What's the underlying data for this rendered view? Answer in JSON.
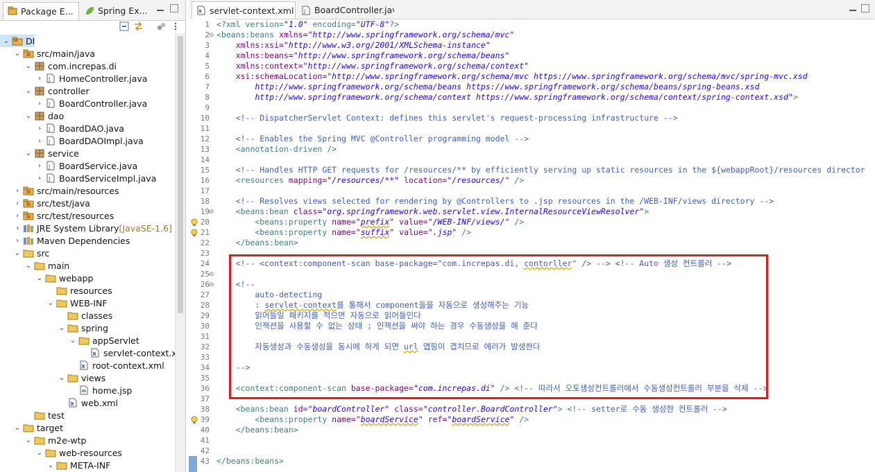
{
  "left_view": {
    "tabs": [
      {
        "label": "Package E...",
        "close": "✕"
      },
      {
        "label": "Spring Ex..."
      }
    ],
    "tree": [
      {
        "label": "DI",
        "depth": 0,
        "expanded": true,
        "icon": "maven-project-icon",
        "selected": true
      },
      {
        "label": "src/main/java",
        "depth": 1,
        "expanded": true,
        "icon": "source-folder-icon"
      },
      {
        "label": "com.increpas.di",
        "depth": 2,
        "expanded": true,
        "icon": "package-icon"
      },
      {
        "label": "HomeController.java",
        "depth": 3,
        "expanded": false,
        "icon": "java-file-icon"
      },
      {
        "label": "controller",
        "depth": 2,
        "expanded": true,
        "icon": "package-icon"
      },
      {
        "label": "BoardController.java",
        "depth": 3,
        "expanded": false,
        "icon": "java-file-icon"
      },
      {
        "label": "dao",
        "depth": 2,
        "expanded": true,
        "icon": "package-icon"
      },
      {
        "label": "BoardDAO.java",
        "depth": 3,
        "expanded": false,
        "icon": "java-interface-icon"
      },
      {
        "label": "BoardDAOImpl.java",
        "depth": 3,
        "expanded": false,
        "icon": "java-file-icon"
      },
      {
        "label": "service",
        "depth": 2,
        "expanded": true,
        "icon": "package-icon"
      },
      {
        "label": "BoardService.java",
        "depth": 3,
        "expanded": false,
        "icon": "java-interface-icon"
      },
      {
        "label": "BoardServiceImpl.java",
        "depth": 3,
        "expanded": false,
        "icon": "java-file-icon"
      },
      {
        "label": "src/main/resources",
        "depth": 1,
        "expanded": false,
        "icon": "source-folder-icon"
      },
      {
        "label": "src/test/java",
        "depth": 1,
        "expanded": false,
        "icon": "source-folder-icon"
      },
      {
        "label": "src/test/resources",
        "depth": 1,
        "expanded": false,
        "icon": "source-folder-icon"
      },
      {
        "label": "JRE System Library",
        "decoration": "[JavaSE-1.6]",
        "depth": 1,
        "expanded": false,
        "icon": "library-icon"
      },
      {
        "label": "Maven Dependencies",
        "depth": 1,
        "expanded": false,
        "icon": "library-icon"
      },
      {
        "label": "src",
        "depth": 1,
        "expanded": true,
        "icon": "folder-icon"
      },
      {
        "label": "main",
        "depth": 2,
        "expanded": true,
        "icon": "folder-icon"
      },
      {
        "label": "webapp",
        "depth": 3,
        "expanded": true,
        "icon": "folder-icon"
      },
      {
        "label": "resources",
        "depth": 4,
        "expanded": null,
        "icon": "folder-icon"
      },
      {
        "label": "WEB-INF",
        "depth": 4,
        "expanded": true,
        "icon": "folder-icon"
      },
      {
        "label": "classes",
        "depth": 5,
        "expanded": null,
        "icon": "folder-icon"
      },
      {
        "label": "spring",
        "depth": 5,
        "expanded": true,
        "icon": "folder-icon"
      },
      {
        "label": "appServlet",
        "depth": 6,
        "expanded": true,
        "icon": "folder-icon"
      },
      {
        "label": "servlet-context.xml",
        "depth": 7,
        "expanded": null,
        "icon": "xml-file-icon"
      },
      {
        "label": "root-context.xml",
        "depth": 6,
        "expanded": null,
        "icon": "xml-file-icon"
      },
      {
        "label": "views",
        "depth": 5,
        "expanded": true,
        "icon": "folder-icon"
      },
      {
        "label": "home.jsp",
        "depth": 6,
        "expanded": null,
        "icon": "jsp-file-icon"
      },
      {
        "label": "web.xml",
        "depth": 5,
        "expanded": null,
        "icon": "xml-file-icon"
      },
      {
        "label": "test",
        "depth": 2,
        "expanded": null,
        "icon": "folder-icon"
      },
      {
        "label": "target",
        "depth": 1,
        "expanded": true,
        "icon": "folder-icon"
      },
      {
        "label": "m2e-wtp",
        "depth": 2,
        "expanded": true,
        "icon": "folder-icon"
      },
      {
        "label": "web-resources",
        "depth": 3,
        "expanded": true,
        "icon": "folder-icon"
      },
      {
        "label": "META-INF",
        "depth": 4,
        "expanded": true,
        "icon": "folder-icon"
      }
    ]
  },
  "editor": {
    "tabs": [
      {
        "label": "servlet-context.xml",
        "close": "✕",
        "active": true
      },
      {
        "label": "BoardController.java",
        "active": false
      }
    ],
    "line_numbers": [
      "1",
      "2",
      "3",
      "4",
      "5",
      "6",
      "7",
      "8",
      "9",
      "10",
      "11",
      "12",
      "13",
      "14",
      "15",
      "16",
      "17",
      "18",
      "19",
      "20",
      "21",
      "22",
      "23",
      "24",
      "25",
      "26",
      "27",
      "28",
      "29",
      "30",
      "31",
      "32",
      "33",
      "34",
      "35",
      "36",
      "37",
      "38",
      "39",
      "40",
      "41",
      "42",
      "43"
    ],
    "fold_markers": {
      "2": "⊖",
      "19": "⊖",
      "25": "⊖",
      "26": "⊖"
    },
    "warning_lines": [
      "20",
      "21",
      "39"
    ],
    "lines": [
      [
        [
          "pi",
          "<?xml version="
        ],
        [
          "vl",
          "\"1.0\""
        ],
        [
          "pi",
          " encoding="
        ],
        [
          "vl",
          "\"UTF-8\""
        ],
        [
          "pi",
          "?>"
        ]
      ],
      [
        [
          "tg",
          "<beans:beans "
        ],
        [
          "at",
          "xmlns="
        ],
        [
          "vl",
          "\"http://www.springframework.org/schema/mvc\""
        ]
      ],
      [
        [
          "at",
          "    xmlns:xsi="
        ],
        [
          "vl",
          "\"http://www.w3.org/2001/XMLSchema-instance\""
        ]
      ],
      [
        [
          "at",
          "    xmlns:beans="
        ],
        [
          "vl",
          "\"http://www.springframework.org/schema/beans\""
        ]
      ],
      [
        [
          "at",
          "    xmlns:context="
        ],
        [
          "vl",
          "\"http://www.springframework.org/schema/context\""
        ]
      ],
      [
        [
          "at",
          "    xsi:schemaLocation="
        ],
        [
          "vl",
          "\"http://www.springframework.org/schema/mvc https://www.springframework.org/schema/mvc/spring-mvc.xsd"
        ]
      ],
      [
        [
          "vl",
          "        http://www.springframework.org/schema/beans https://www.springframework.org/schema/beans/spring-beans.xsd"
        ]
      ],
      [
        [
          "vl",
          "        http://www.springframework.org/schema/context https://www.springframework.org/schema/context/spring-context.xsd\""
        ],
        [
          "tg",
          ">"
        ]
      ],
      [],
      [
        [
          "cm",
          "    <!-- DispatcherServlet Context: defines this servlet's request-processing infrastructure -->"
        ]
      ],
      [],
      [
        [
          "cm",
          "    <!-- Enables the Spring MVC @Controller programming model -->"
        ]
      ],
      [
        [
          "tg",
          "    <annotation-driven />"
        ]
      ],
      [],
      [
        [
          "cm",
          "    <!-- Handles HTTP GET requests for /resources/** by efficiently serving up static resources in the ${webappRoot}/resources director"
        ]
      ],
      [
        [
          "tg",
          "    <resources "
        ],
        [
          "at",
          "mapping="
        ],
        [
          "vl",
          "\"/resources/**\""
        ],
        [
          "at",
          " location="
        ],
        [
          "vl",
          "\"/resources/\""
        ],
        [
          "tg",
          " />"
        ]
      ],
      [],
      [
        [
          "cm",
          "    <!-- Resolves views selected for rendering by @Controllers to .jsp resources in the /WEB-INF/views directory -->"
        ]
      ],
      [
        [
          "tg",
          "    <beans:bean "
        ],
        [
          "at",
          "class="
        ],
        [
          "vl",
          "\"org.springframework.web.servlet.view.InternalResourceViewResolver\""
        ],
        [
          "tg",
          ">"
        ]
      ],
      [
        [
          "tg",
          "        <beans:property "
        ],
        [
          "at",
          "name="
        ],
        [
          "vl",
          "\"prefix\""
        ],
        [
          "at",
          " value="
        ],
        [
          "vl",
          "\"/WEB-INF/views/\""
        ],
        [
          "tg",
          " />"
        ]
      ],
      [
        [
          "tg",
          "        <beans:property "
        ],
        [
          "at",
          "name="
        ],
        [
          "vl",
          "\"suffix\""
        ],
        [
          "at",
          " value="
        ],
        [
          "vl",
          "\".jsp\""
        ],
        [
          "tg",
          " />"
        ]
      ],
      [
        [
          "tg",
          "    </beans:bean>"
        ]
      ],
      [],
      [
        [
          "cm",
          "    <!-- <context:component-scan base-package=\"com.increpas.di, contorller\" /> --> <!-- Auto 생성 컨트롤러 -->"
        ]
      ],
      [],
      [
        [
          "cm",
          "    <!--"
        ]
      ],
      [
        [
          "cm",
          "        auto-detecting"
        ]
      ],
      [
        [
          "cm",
          "        : servlet-context를 통해서 component들을 자동으로 생성해주는 기능"
        ]
      ],
      [
        [
          "cm",
          "        읽어들일 패키지를 적으면 자동으로 읽어들인다"
        ]
      ],
      [
        [
          "cm",
          "        인젝션을 사용할 수 없는 상태 ; 인젝션을 써야 하는 경우 수동생성을 해 준다"
        ]
      ],
      [],
      [
        [
          "cm",
          "        자동생성과 수동생성을 동시에 하게 되면 url 맵핑이 겹치므로 에러가 발생한다"
        ]
      ],
      [],
      [
        [
          "cm",
          "    -->"
        ]
      ],
      [],
      [
        [
          "tg",
          "    <context:component-scan "
        ],
        [
          "at",
          "base-package="
        ],
        [
          "vl",
          "\"com.increpas.di\""
        ],
        [
          "tg",
          " /> "
        ],
        [
          "cm",
          "<!-- 따라서 오토생성컨트롤러에서 수동생성컨트롤러 부분을 삭제 -->"
        ]
      ],
      [],
      [
        [
          "tg",
          "    <beans:bean "
        ],
        [
          "at",
          "id="
        ],
        [
          "vl",
          "\"boardController\""
        ],
        [
          "at",
          " class="
        ],
        [
          "vl",
          "\"controller.BoardController\""
        ],
        [
          "tg",
          "> "
        ],
        [
          "cm",
          "<!-- setter로 수동 생성한 컨트롤러 -->"
        ]
      ],
      [
        [
          "tg",
          "        <beans:property "
        ],
        [
          "at",
          "name="
        ],
        [
          "vl",
          "\"boardService\""
        ],
        [
          "at",
          " ref="
        ],
        [
          "vl",
          "\"boardService\""
        ],
        [
          "tg",
          " />"
        ]
      ],
      [
        [
          "tg",
          "    </beans:bean>"
        ]
      ],
      [],
      [],
      [
        [
          "tg",
          "</beans:beans>"
        ]
      ]
    ]
  }
}
